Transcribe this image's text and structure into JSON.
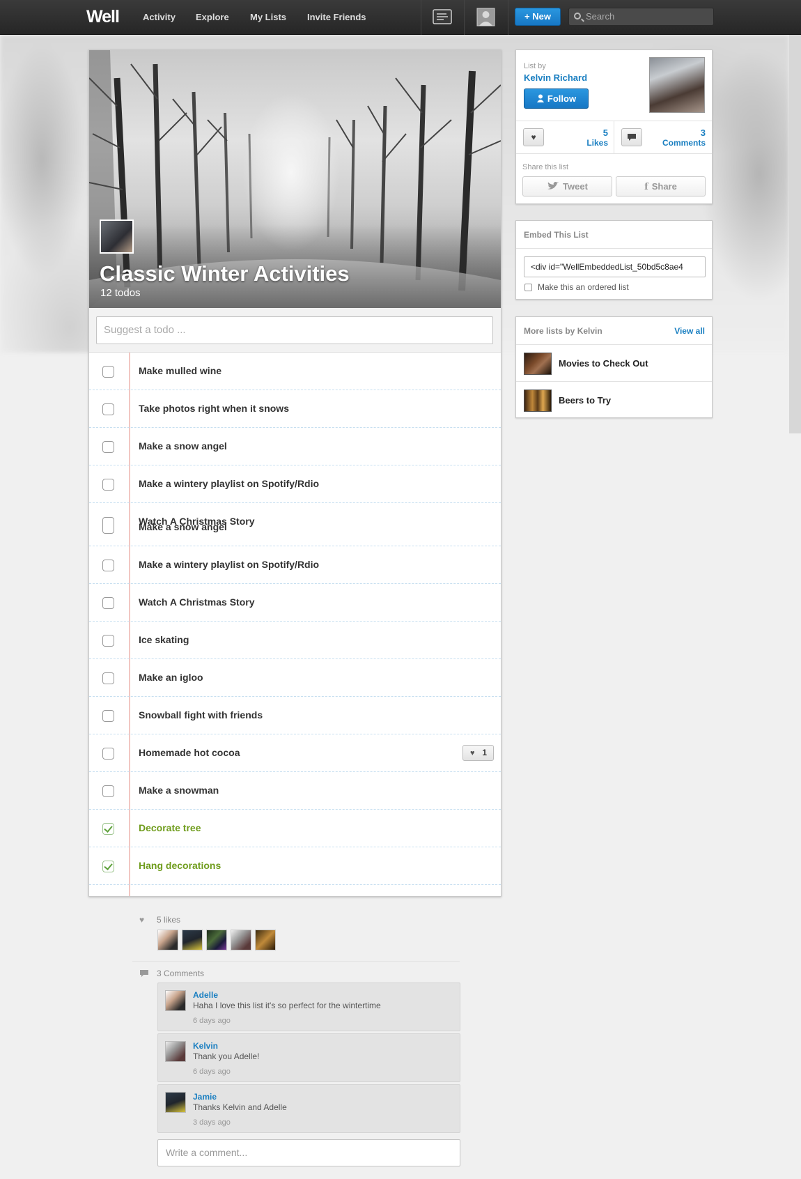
{
  "nav": {
    "logo": "Well",
    "links": [
      "Activity",
      "Explore",
      "My Lists",
      "Invite Friends"
    ],
    "new_label": "+ New",
    "search_placeholder": "Search"
  },
  "list": {
    "title": "Classic Winter Activities",
    "count": "12 todos",
    "suggest_placeholder": "Suggest a todo ...",
    "todos": [
      {
        "text": "Make mulled wine",
        "done": false
      },
      {
        "text": "Take photos right when it snows",
        "done": false
      },
      {
        "text": "Make a snow angel",
        "done": false
      },
      {
        "text": "Make a wintery playlist on Spotify/Rdio",
        "done": false
      },
      {
        "text": "Watch A Christmas Story",
        "overlap_text": "Make a snow angel",
        "done": false
      },
      {
        "text": "Make a wintery playlist on Spotify/Rdio",
        "done": false
      },
      {
        "text": "Watch A Christmas Story",
        "done": false
      },
      {
        "text": "Ice skating",
        "done": false
      },
      {
        "text": "Make an igloo",
        "done": false
      },
      {
        "text": "Snowball fight with friends",
        "done": false
      },
      {
        "text": "Homemade hot cocoa",
        "done": false,
        "likes": "1"
      },
      {
        "text": "Make a snowman",
        "done": false
      },
      {
        "text": "Decorate tree",
        "done": true
      },
      {
        "text": "Hang decorations",
        "done": true
      }
    ]
  },
  "likes": {
    "label": "5 likes"
  },
  "comments": {
    "label": "3 Comments",
    "items": [
      {
        "name": "Adelle",
        "body": "Haha I love this list it's so perfect for the wintertime",
        "time": "6 days ago"
      },
      {
        "name": "Kelvin",
        "body": "Thank you Adelle!",
        "time": "6 days ago"
      },
      {
        "name": "Jamie",
        "body": "Thanks Kelvin and Adelle",
        "time": "3 days ago"
      }
    ],
    "write_placeholder": "Write a comment..."
  },
  "owner": {
    "list_by": "List by",
    "name": "Kelvin Richard",
    "follow_label": "Follow",
    "likes_count": "5",
    "likes_label": "Likes",
    "comments_count": "3",
    "comments_label": "Comments",
    "share_label": "Share this list",
    "tweet_label": "Tweet",
    "share_btn_label": "Share"
  },
  "embed": {
    "title": "Embed This List",
    "code": "<div id=\"WellEmbeddedList_50bd5c8ae4",
    "ordered_label": "Make this an ordered list"
  },
  "more": {
    "title": "More lists by Kelvin",
    "view_all": "View all",
    "items": [
      "Movies to Check Out",
      "Beers to Try"
    ]
  },
  "colors": {
    "accent": "#1a7fc1",
    "done_green": "#6f9c1c",
    "nav_bg": "#2e2e2e"
  }
}
